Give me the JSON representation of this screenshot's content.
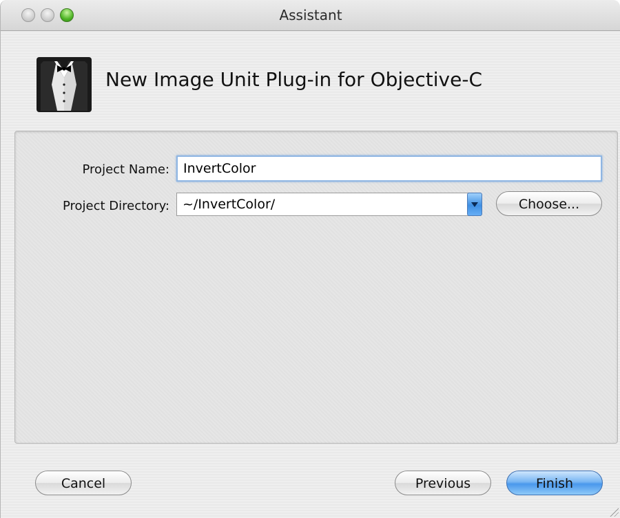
{
  "window": {
    "title": "Assistant"
  },
  "header": {
    "title": "New Image Unit Plug-in for Objective-C",
    "icon": "tuxedo-icon"
  },
  "form": {
    "project_name_label": "Project Name:",
    "project_name_value": "InvertColor",
    "project_directory_label": "Project Directory:",
    "project_directory_value": "~/InvertColor/",
    "choose_label": "Choose..."
  },
  "buttons": {
    "cancel": "Cancel",
    "previous": "Previous",
    "finish": "Finish"
  },
  "colors": {
    "default_button": "#4a98ec",
    "focus_ring": "#8fb6e3"
  }
}
